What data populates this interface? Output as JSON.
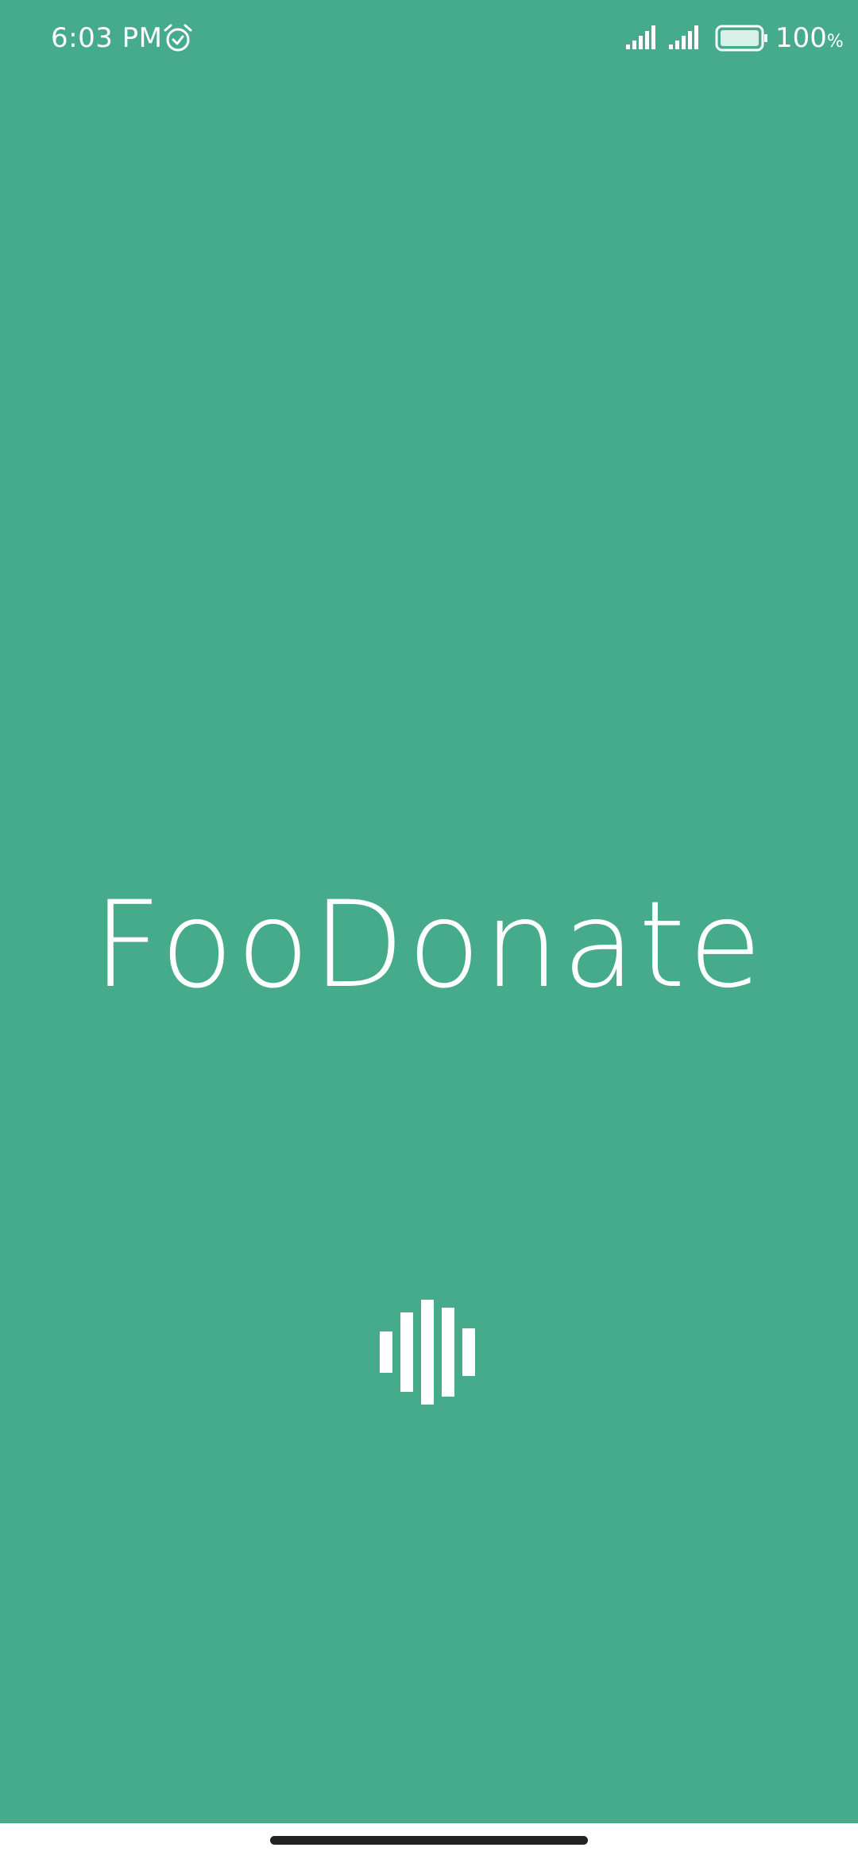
{
  "colors": {
    "background": "#46ab8b",
    "foreground": "#ffffff",
    "nav_bar": "#ffffff",
    "home_indicator": "#222222"
  },
  "status_bar": {
    "time": "6:03 PM",
    "icons": [
      "alarm-icon",
      "signal-icon",
      "signal-icon",
      "battery-icon"
    ],
    "battery_level": "100",
    "battery_unit": "%"
  },
  "splash": {
    "app_name": "FooDonate",
    "loader_icon": "audio-bars-icon"
  }
}
